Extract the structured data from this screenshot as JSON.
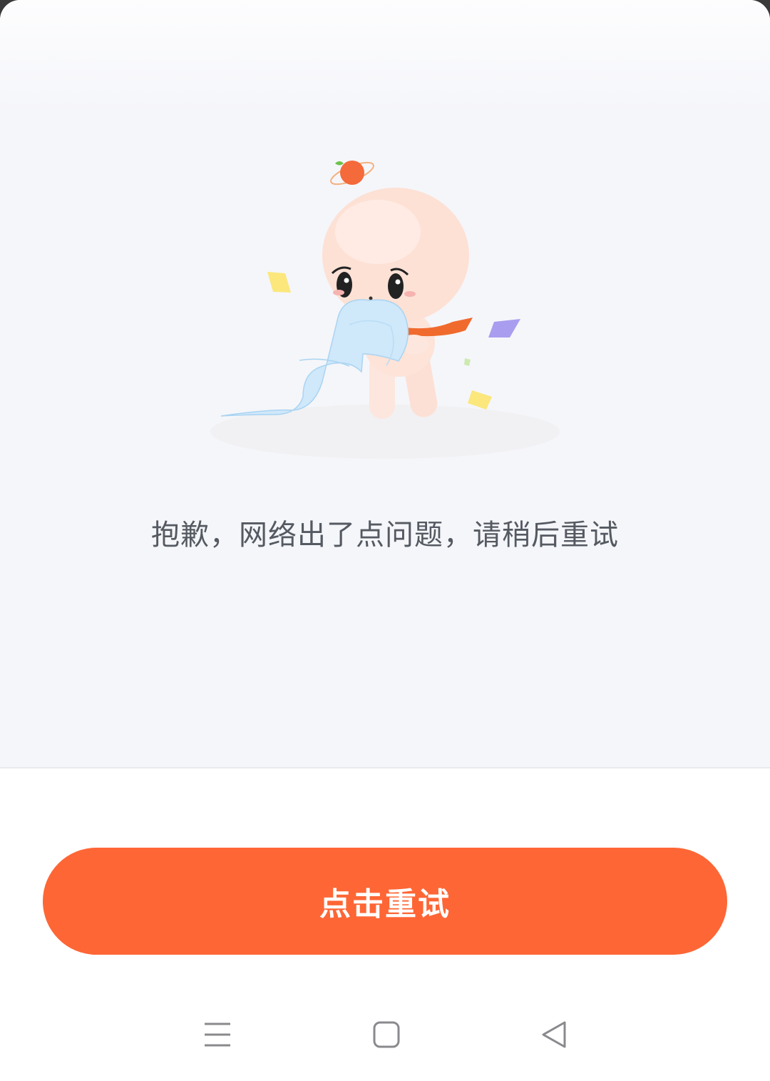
{
  "error": {
    "message": "抱歉，网络出了点问题，请稍后重试",
    "illustration_icon": "sad-character-illustration"
  },
  "retry_button": {
    "label": "点击重试",
    "color": "#fe6635"
  },
  "nav_bar": {
    "menu_icon": "menu-icon",
    "home_icon": "home-square-icon",
    "back_icon": "back-triangle-icon"
  },
  "colors": {
    "background": "#f5f6fa",
    "text": "#555a62",
    "accent": "#fe6635"
  }
}
